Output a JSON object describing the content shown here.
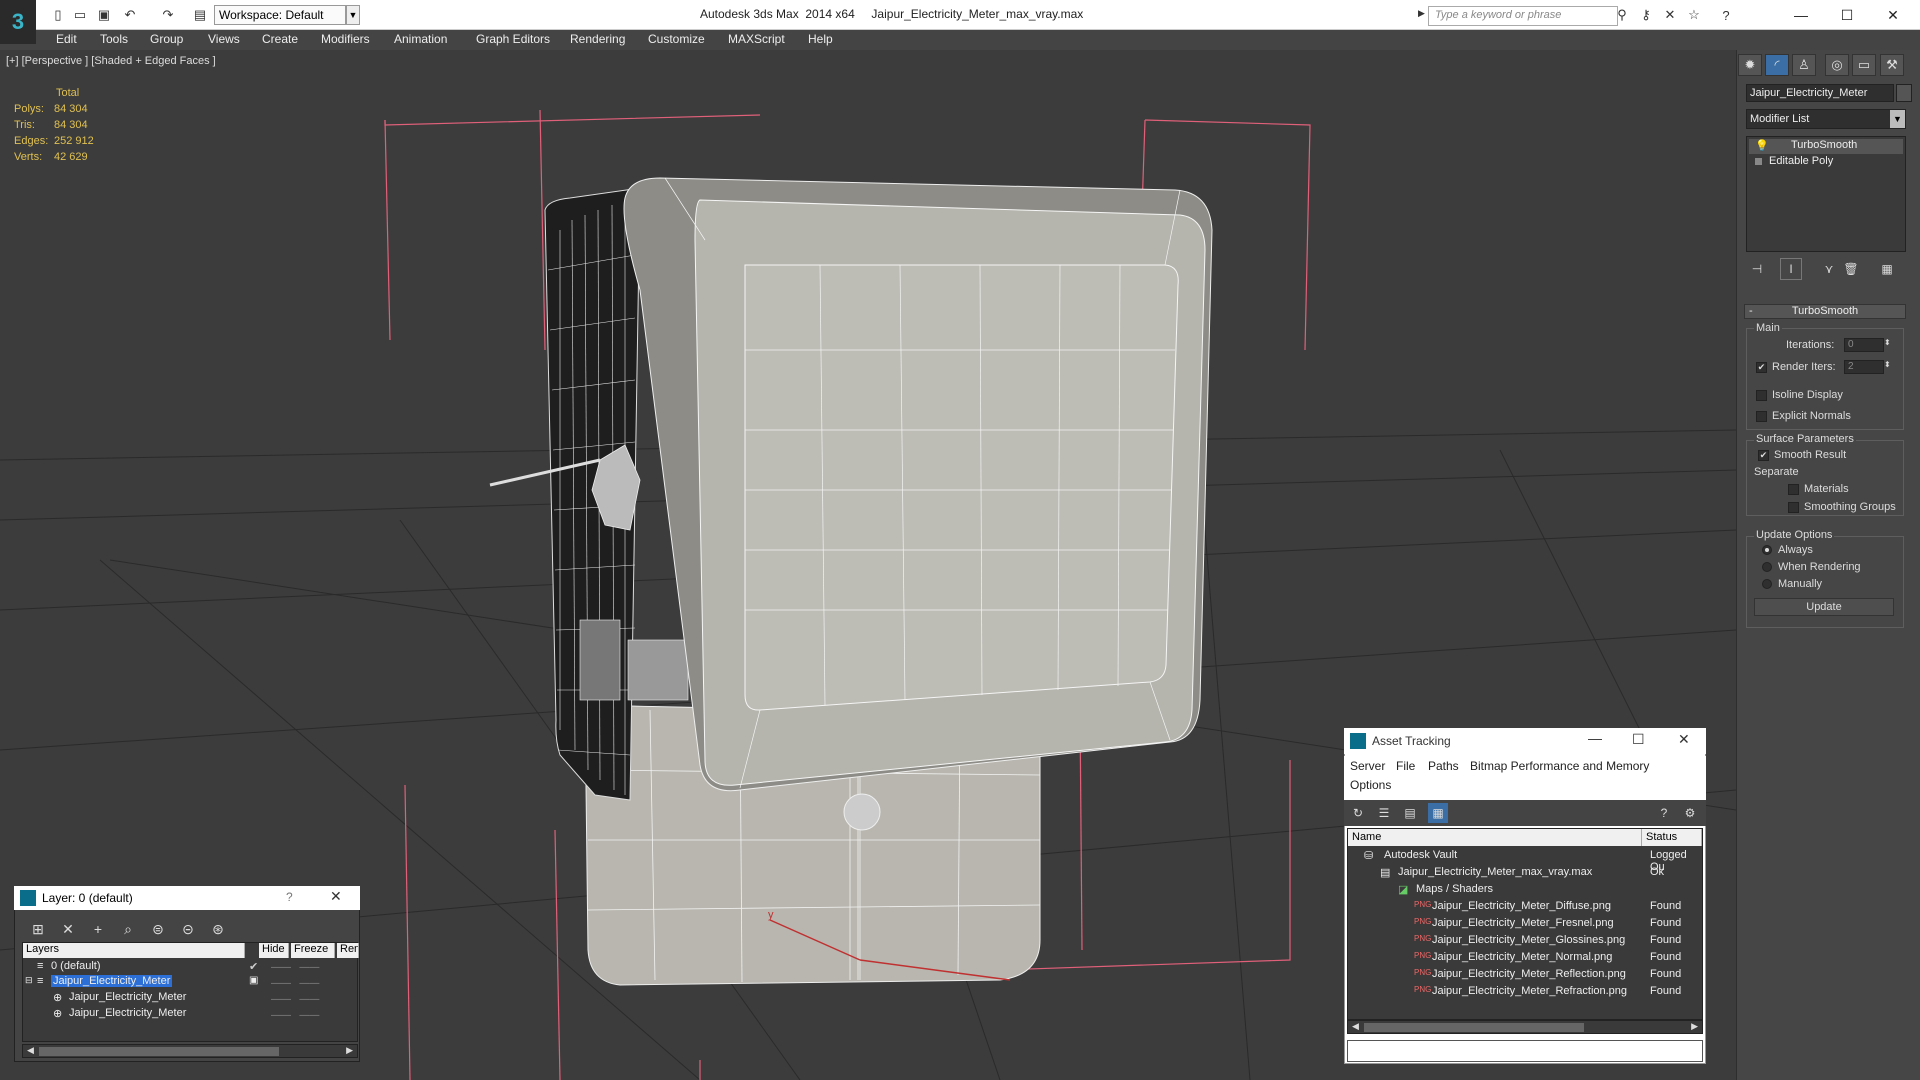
{
  "app": {
    "title": "Autodesk 3ds Max  2014 x64     Jaipur_Electricity_Meter_max_vray.max",
    "workspace": "Workspace: Default",
    "search_placeholder": "Type a keyword or phrase"
  },
  "menu": [
    "Edit",
    "Tools",
    "Group",
    "Views",
    "Create",
    "Modifiers",
    "Animation",
    "Graph Editors",
    "Rendering",
    "Customize",
    "MAXScript",
    "Help"
  ],
  "viewport": {
    "label": "[+] [Perspective ] [Shaded + Edged Faces ]",
    "stats": {
      "header": "Total",
      "rows": [
        {
          "label": "Polys:",
          "value": "84 304"
        },
        {
          "label": "Tris:",
          "value": "84 304"
        },
        {
          "label": "Edges:",
          "value": "252 912"
        },
        {
          "label": "Verts:",
          "value": "42 629"
        }
      ]
    },
    "gizmo_axis": "y"
  },
  "command_panel": {
    "object_name": "Jaipur_Electricity_Meter",
    "modifier_list": "Modifier List",
    "stack": [
      "TurboSmooth",
      "Editable Poly"
    ],
    "rollout_title": "TurboSmooth",
    "main": {
      "group": "Main",
      "iterations_label": "Iterations:",
      "iterations_value": "0",
      "render_iters_label": "Render Iters:",
      "render_iters_value": "2",
      "render_iters_checked": true,
      "isoline_label": "Isoline Display",
      "explicit_label": "Explicit Normals"
    },
    "surface": {
      "group": "Surface Parameters",
      "smooth_result": "Smooth Result",
      "separate": "Separate",
      "materials": "Materials",
      "smoothing_groups": "Smoothing Groups"
    },
    "update": {
      "group": "Update Options",
      "always": "Always",
      "when_rendering": "When Rendering",
      "manually": "Manually",
      "button": "Update"
    }
  },
  "layer_dialog": {
    "title": "Layer: 0 (default)",
    "columns": [
      "Layers",
      "Hide",
      "Freeze",
      "Ren"
    ],
    "rows": [
      {
        "name": "0 (default)",
        "indent": 0
      },
      {
        "name": "Jaipur_Electricity_Meter",
        "indent": 0,
        "selected": true
      },
      {
        "name": "Jaipur_Electricity_Meter",
        "indent": 1
      },
      {
        "name": "Jaipur_Electricity_Meter",
        "indent": 1
      }
    ]
  },
  "asset_tracking": {
    "title": "Asset Tracking",
    "menu": [
      "Server",
      "File",
      "Paths",
      "Bitmap Performance and Memory",
      "Options"
    ],
    "columns": [
      "Name",
      "Status"
    ],
    "rows": [
      {
        "name": "Autodesk Vault",
        "status": "Logged Ou",
        "indent": 0
      },
      {
        "name": "Jaipur_Electricity_Meter_max_vray.max",
        "status": "Ok",
        "indent": 1
      },
      {
        "name": "Maps / Shaders",
        "status": "",
        "indent": 2
      },
      {
        "name": "Jaipur_Electricity_Meter_Diffuse.png",
        "status": "Found",
        "indent": 3
      },
      {
        "name": "Jaipur_Electricity_Meter_Fresnel.png",
        "status": "Found",
        "indent": 3
      },
      {
        "name": "Jaipur_Electricity_Meter_Glossines.png",
        "status": "Found",
        "indent": 3
      },
      {
        "name": "Jaipur_Electricity_Meter_Normal.png",
        "status": "Found",
        "indent": 3
      },
      {
        "name": "Jaipur_Electricity_Meter_Reflection.png",
        "status": "Found",
        "indent": 3
      },
      {
        "name": "Jaipur_Electricity_Meter_Refraction.png",
        "status": "Found",
        "indent": 3
      }
    ]
  }
}
